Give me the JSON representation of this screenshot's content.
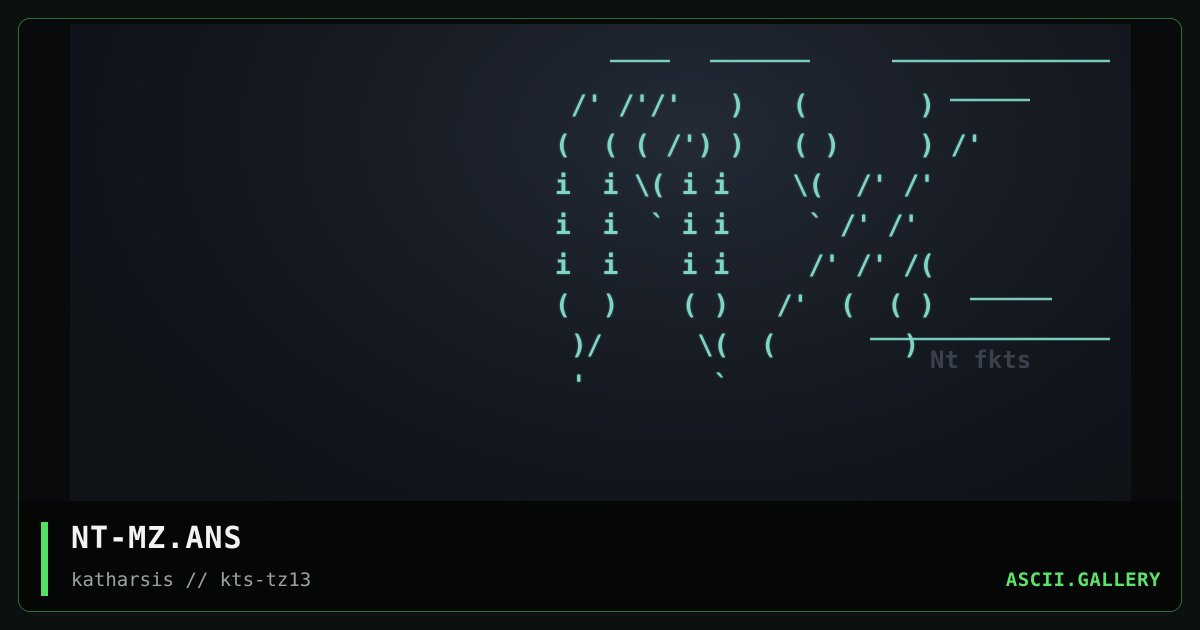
{
  "card": {
    "title": "NT-MZ.ANS",
    "credit": "katharsis // kts-tz13",
    "brand": "ASCII.GALLERY"
  },
  "artwork": {
    "ascii_lines": [
      "   __  ____     _______",
      " /' /'/'   )   (       )",
      "(  ( ( /') )   ( )  __ ) /'",
      "i  i \\( i i    \\(  /' /'",
      "i  i  ` i i     ` /' /'",
      "i  i    i i     /' /' /(",
      "(  )    ( )   /'  (__( )",
      " )/      \\(  (________)",
      " '        `"
    ],
    "signature": "Nt fkts"
  },
  "colors": {
    "accent": "#54e060",
    "brand": "#5de36a",
    "art_cyan": "#7fd6c6",
    "border": "#2c6e35"
  }
}
